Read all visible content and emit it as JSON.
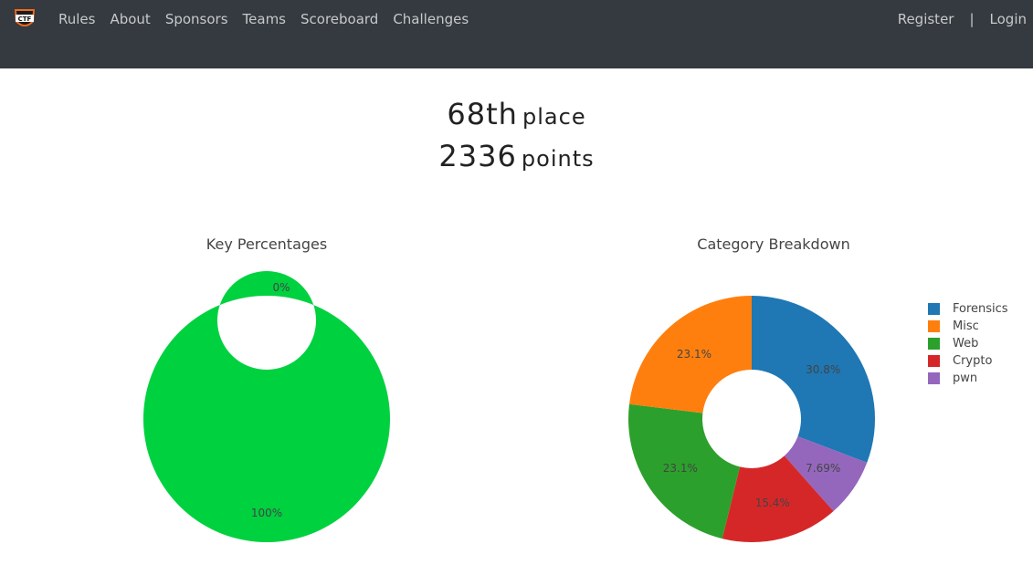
{
  "nav": {
    "left": [
      "Rules",
      "About",
      "Sponsors",
      "Teams",
      "Scoreboard",
      "Challenges"
    ],
    "register": "Register",
    "separator": "|",
    "login": "Login"
  },
  "stats": {
    "place_value": "68th",
    "place_label": "place",
    "points_value": "2336",
    "points_label": "points"
  },
  "chart_data": [
    {
      "type": "pie",
      "title": "Key Percentages",
      "hole": true,
      "slices": [
        {
          "label": "",
          "value": 100,
          "text": "100%",
          "color": "#00d13f"
        },
        {
          "label": "",
          "value": 0,
          "text": "0%",
          "color": "#cf1c36"
        }
      ]
    },
    {
      "type": "pie",
      "title": "Category Breakdown",
      "hole": true,
      "legend_position": "right",
      "slices": [
        {
          "label": "Forensics",
          "value": 30.8,
          "text": "30.8%",
          "color": "#1f77b4"
        },
        {
          "label": "pwn",
          "value": 7.69,
          "text": "7.69%",
          "color": "#9467bd"
        },
        {
          "label": "Crypto",
          "value": 15.4,
          "text": "15.4%",
          "color": "#d62728"
        },
        {
          "label": "Web",
          "value": 23.1,
          "text": "23.1%",
          "color": "#2ca02c"
        },
        {
          "label": "Misc",
          "value": 23.1,
          "text": "23.1%",
          "color": "#ff7f0e"
        }
      ],
      "legend": [
        {
          "label": "Forensics",
          "color": "#1f77b4"
        },
        {
          "label": "Misc",
          "color": "#ff7f0e"
        },
        {
          "label": "Web",
          "color": "#2ca02c"
        },
        {
          "label": "Crypto",
          "color": "#d62728"
        },
        {
          "label": "pwn",
          "color": "#9467bd"
        }
      ]
    }
  ]
}
